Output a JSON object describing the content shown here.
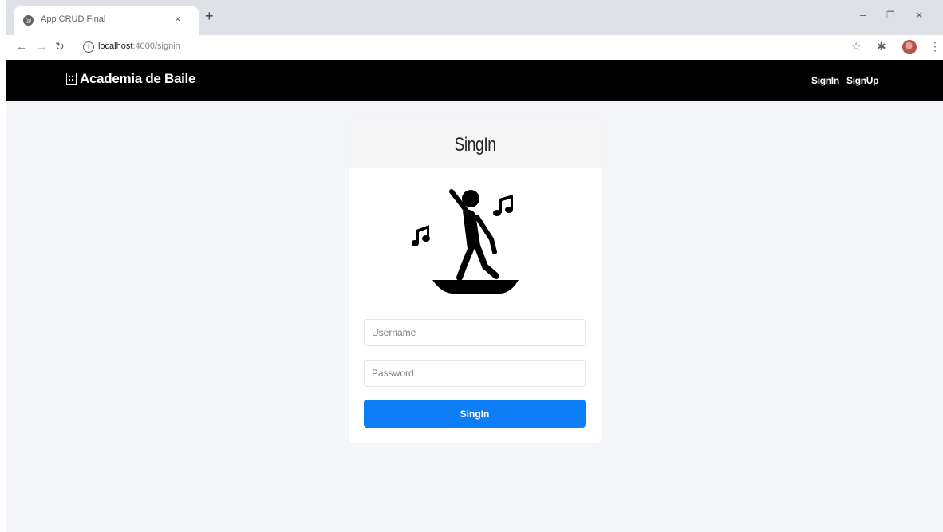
{
  "browser": {
    "tab_title": "App CRUD Final",
    "tab_close": "×",
    "new_tab": "+",
    "url_host": "localhost",
    "url_path": ":4000/signin",
    "minimize": "–",
    "restore": "❐",
    "close": "✕"
  },
  "navbar": {
    "brand": "Academia de Baile",
    "links": [
      {
        "label": "SignIn"
      },
      {
        "label": "SignUp"
      }
    ]
  },
  "card": {
    "title": "SingIn",
    "username_placeholder": "Username",
    "password_placeholder": "Password",
    "submit_label": "SingIn"
  },
  "icons": {
    "dancer": "dancing-figure-with-music-notes-icon"
  },
  "colors": {
    "navbar_bg": "#000000",
    "page_bg": "#f4f6f9",
    "button_bg": "#0d7ef5"
  }
}
